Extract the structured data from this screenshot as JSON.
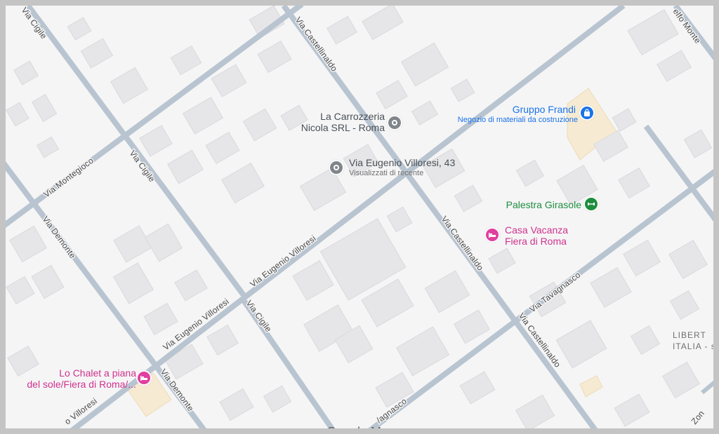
{
  "map": {
    "attribution": "Google Maps",
    "colors": {
      "land": "#f5f5f6",
      "road": "#b8c4d0",
      "building": "#e6e6e8",
      "lot": "#f6ead2",
      "frame": "#c4c4c4",
      "poi_grey": "#4a5055",
      "poi_blue": "#1a73e8",
      "poi_green": "#1e8e3e",
      "poi_pink": "#d0318c"
    }
  },
  "streets": {
    "cigile_top": "Via Cigile",
    "cigile_mid": "Via Cigile",
    "cigile_bottom": "Via Cigile",
    "castellinaldo_top": "Via Castellinaldo",
    "castellinaldo_mid": "Via Castellinaldo",
    "castellinaldo_bottom": "Via Castellinaldo",
    "montegioco": "Via Montegioco",
    "demonte_top": "Via Demonte",
    "demonte_bottom": "Via Demonte",
    "villoresi_mid": "Via Eugenio Villoresi",
    "villoresi_low": "Via Eugenio Villoresi",
    "villoresi_edge": "o Villoresi",
    "tavagnasco": "Via Tavagnasco",
    "tavagnasco_low": "/agnasco",
    "montefeltro_edge": "elfo Monte",
    "edge_right": "Zon"
  },
  "pois": {
    "carrozzeria": {
      "title_line1": "La Carrozzeria",
      "title_line2": "Nicola SRL - Roma",
      "icon": "pin-icon"
    },
    "villoresi43": {
      "title": "Via Eugenio Villoresi, 43",
      "subtitle": "Visualizzati di recente",
      "icon": "pin-icon"
    },
    "frandi": {
      "title": "Gruppo Frandi",
      "subtitle": "Negozio di materiali da costruzione",
      "icon": "shopping-bag-icon"
    },
    "girasole": {
      "title": "Palestra Girasole",
      "icon": "gym-icon"
    },
    "casa_vacanza": {
      "title_line1": "Casa Vacanza",
      "title_line2": "Fiera di Roma",
      "icon": "bed-icon"
    },
    "lo_chalet": {
      "title_line1": "Lo Chalet a piana",
      "title_line2": "del sole/Fiera di Roma/...",
      "icon": "bed-icon"
    }
  },
  "area_label": {
    "line1": "LIBERT",
    "line2": "ITALIA - s"
  }
}
